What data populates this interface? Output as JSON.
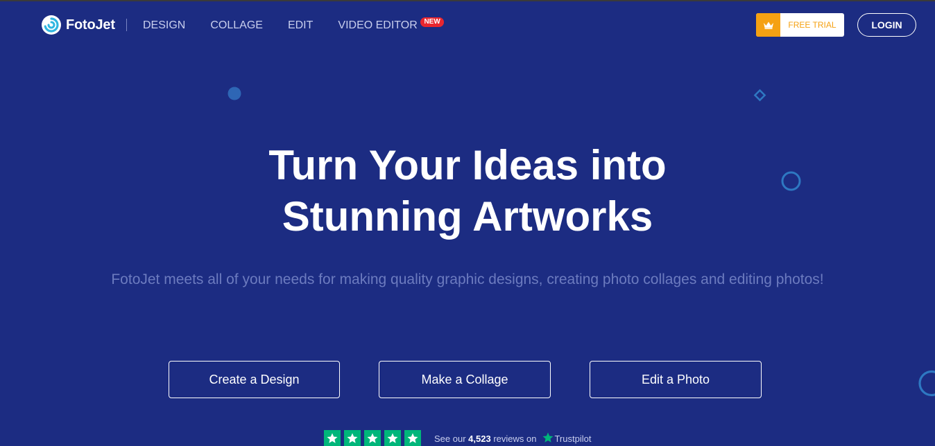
{
  "header": {
    "brand": "FotoJet",
    "nav": [
      {
        "label": "DESIGN"
      },
      {
        "label": "COLLAGE"
      },
      {
        "label": "EDIT"
      },
      {
        "label": "VIDEO EDITOR",
        "badge": "NEW"
      }
    ],
    "free_trial_label": "FREE TRIAL",
    "login_label": "LOGIN"
  },
  "hero": {
    "title_line1": "Turn Your Ideas into",
    "title_line2": "Stunning Artworks",
    "subtitle": "FotoJet meets all of your needs for making quality graphic designs, creating photo collages and editing photos!"
  },
  "cta": [
    {
      "label": "Create a Design"
    },
    {
      "label": "Make a Collage"
    },
    {
      "label": "Edit a Photo"
    }
  ],
  "trustpilot": {
    "prefix": "See our ",
    "count": "4,523",
    "suffix": " reviews on",
    "brand": "Trustpilot",
    "stars": 5
  },
  "colors": {
    "background": "#1c2c82",
    "accent": "#f5a112",
    "badge": "#e8262f",
    "trustpilot_green": "#00b67a"
  },
  "icons": [
    "fotojet-logo-icon",
    "crown-icon",
    "star-icon",
    "trustpilot-star-icon"
  ]
}
